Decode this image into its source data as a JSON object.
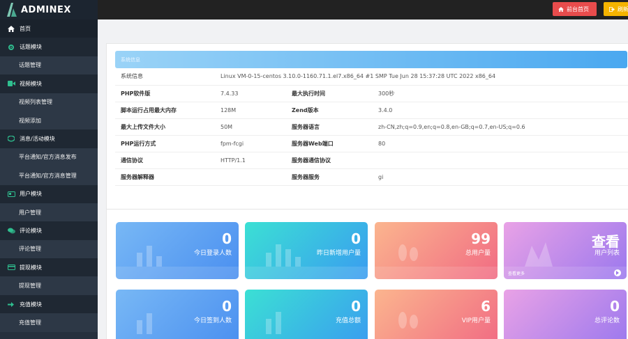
{
  "app": {
    "logo_text": "ADMINEX"
  },
  "sidebar": {
    "items": [
      {
        "label": "首页",
        "kind": "group",
        "icon": "home-icon"
      },
      {
        "label": "话题模块",
        "kind": "group",
        "icon": "cog-icon"
      },
      {
        "label": "话题管理",
        "kind": "sub"
      },
      {
        "label": "视频模块",
        "kind": "group",
        "icon": "video-icon"
      },
      {
        "label": "视频列表管理",
        "kind": "sub"
      },
      {
        "label": "视频添加",
        "kind": "sub"
      },
      {
        "label": "消息/活动模块",
        "kind": "group",
        "icon": "chat-icon"
      },
      {
        "label": "平台通知/官方消息发布",
        "kind": "sub"
      },
      {
        "label": "平台通知/官方消息管理",
        "kind": "sub"
      },
      {
        "label": "用户模块",
        "kind": "group",
        "icon": "id-card-icon"
      },
      {
        "label": "用户管理",
        "kind": "sub"
      },
      {
        "label": "评论模块",
        "kind": "group",
        "icon": "comments-icon"
      },
      {
        "label": "评论管理",
        "kind": "sub"
      },
      {
        "label": "提现模块",
        "kind": "group",
        "icon": "credit-card-icon"
      },
      {
        "label": "提现管理",
        "kind": "sub"
      },
      {
        "label": "充值模块",
        "kind": "group",
        "icon": "sign-in-icon"
      },
      {
        "label": "充值管理",
        "kind": "sub"
      }
    ]
  },
  "topbar": {
    "home_button": "前台首页",
    "second_button": "刷新"
  },
  "sysinfo": {
    "header": "系统信息",
    "system_label": "系统信息",
    "system_value": "Linux VM-0-15-centos 3.10.0-1160.71.1.el7.x86_64 #1 SMP Tue Jun 28 15:37:28 UTC 2022 x86_64",
    "rows": [
      {
        "k1": "PHP软件版",
        "v1": "7.4.33",
        "k2": "最大执行时间",
        "v2": "300秒"
      },
      {
        "k1": "脚本运行占用最大内存",
        "v1": "128M",
        "k2": "Zend版本",
        "v2": "3.4.0"
      },
      {
        "k1": "最大上传文件大小",
        "v1": "50M",
        "k2": "服务器语言",
        "v2": "zh-CN,zh;q=0.9,en;q=0.8,en-GB;q=0.7,en-US;q=0.6"
      },
      {
        "k1": "PHP运行方式",
        "v1": "fpm-fcgi",
        "k2": "服务器Web端口",
        "v2": "80"
      },
      {
        "k1": "通信协议",
        "v1": "HTTP/1.1",
        "k2": "服务器通信协议",
        "v2": ""
      },
      {
        "k1": "服务器解释器",
        "v1": "",
        "k2": "服务器服务",
        "v2": "gi"
      }
    ]
  },
  "cards": [
    {
      "value": "0",
      "label": "今日登录人数",
      "color": "blue",
      "foot": ""
    },
    {
      "value": "0",
      "label": "昨日新增用户量",
      "color": "teal",
      "foot": ""
    },
    {
      "value": "99",
      "label": "总用户量",
      "color": "orange",
      "foot": ""
    },
    {
      "value": "查看",
      "label": "用户列表",
      "color": "purple",
      "foot": "查看更多"
    },
    {
      "value": "0",
      "label": "今日签到人数",
      "color": "blue",
      "foot": ""
    },
    {
      "value": "0",
      "label": "充值总额",
      "color": "teal",
      "foot": ""
    },
    {
      "value": "6",
      "label": "VIP用户量",
      "color": "orange",
      "foot": ""
    },
    {
      "value": "0",
      "label": "总评论数",
      "color": "purple",
      "foot": ""
    }
  ]
}
